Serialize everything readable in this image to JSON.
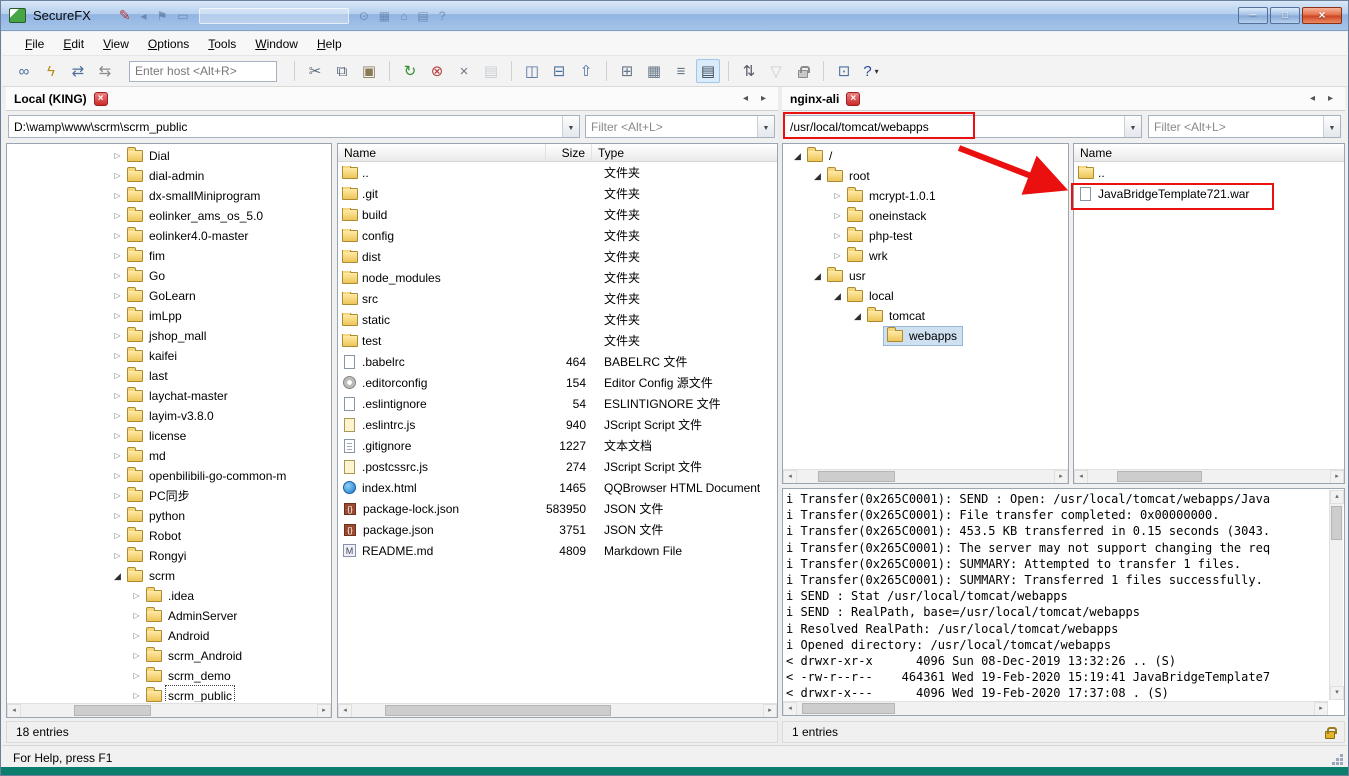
{
  "window": {
    "title": "SecureFX"
  },
  "menu": {
    "items": [
      "File",
      "Edit",
      "View",
      "Options",
      "Tools",
      "Window",
      "Help"
    ]
  },
  "toolbar": {
    "host_placeholder": "Enter host <Alt+R>",
    "buttons": [
      {
        "name": "connect-icon",
        "glyph": "∞",
        "color": "#4d6f9d"
      },
      {
        "name": "quick-connect-icon",
        "glyph": "ϟ",
        "color": "#b98c1e"
      },
      {
        "name": "reconnect-icon",
        "glyph": "⇄",
        "color": "#4d6f9d"
      },
      {
        "name": "connect-in-tab-icon",
        "glyph": "⇆",
        "color": "#8a8a8a"
      },
      {
        "host": true
      },
      {
        "sep": true
      },
      {
        "name": "cut-icon",
        "glyph": "✂",
        "color": "#5a6b7c"
      },
      {
        "name": "copy-icon",
        "glyph": "⧉",
        "color": "#5a6b7c"
      },
      {
        "name": "paste-icon",
        "glyph": "▣",
        "color": "#8a7a55"
      },
      {
        "sep": true
      },
      {
        "name": "refresh-icon",
        "glyph": "↻",
        "color": "#2f8f2f"
      },
      {
        "name": "stop-icon",
        "glyph": "⊗",
        "color": "#b54040"
      },
      {
        "name": "delete-icon",
        "glyph": "×",
        "color": "#6a7a8a"
      },
      {
        "name": "properties-icon",
        "glyph": "▤",
        "color": "#98a4b0",
        "disabled": true
      },
      {
        "sep": true
      },
      {
        "name": "pane-layout-icon",
        "glyph": "◫",
        "color": "#4d6f9d"
      },
      {
        "name": "swap-panes-icon",
        "glyph": "⊟",
        "color": "#4d6f9d"
      },
      {
        "name": "folder-up-icon",
        "glyph": "⇧",
        "color": "#4d6f9d"
      },
      {
        "sep": true
      },
      {
        "name": "large-icons-view-icon",
        "glyph": "⊞",
        "color": "#667788"
      },
      {
        "name": "small-icons-view-icon",
        "glyph": "▦",
        "color": "#667788"
      },
      {
        "name": "list-view-icon",
        "glyph": "≡",
        "color": "#667788"
      },
      {
        "name": "details-view-icon",
        "glyph": "▤",
        "color": "#334455",
        "active": true
      },
      {
        "sep": true
      },
      {
        "name": "sort-icon",
        "glyph": "⇅",
        "color": "#556"
      },
      {
        "name": "filter-icon",
        "glyph": "▽",
        "color": "#99a",
        "disabled": true
      },
      {
        "name": "lock-icon",
        "glyph": "lock",
        "color": "#888"
      },
      {
        "sep": true
      },
      {
        "name": "transfer-window-icon",
        "glyph": "⊡",
        "color": "#4d6f9d"
      },
      {
        "name": "help-icon",
        "glyph": "?",
        "color": "#2a4a9a",
        "dropdown": true
      }
    ]
  },
  "left_pane": {
    "tab": "Local (KING)",
    "path": "D:\\wamp\\www\\scrm\\scrm_public",
    "filter_placeholder": "Filter <Alt+L>",
    "columns": [
      "Name",
      "Size",
      "Type"
    ],
    "tree": [
      {
        "label": "Dial",
        "level": 0,
        "state": "collapsed"
      },
      {
        "label": "dial-admin",
        "level": 0,
        "state": "collapsed"
      },
      {
        "label": "dx-smallMiniprogram",
        "level": 0,
        "state": "collapsed"
      },
      {
        "label": "eolinker_ams_os_5.0",
        "level": 0,
        "state": "collapsed"
      },
      {
        "label": "eolinker4.0-master",
        "level": 0,
        "state": "collapsed"
      },
      {
        "label": "fim",
        "level": 0,
        "state": "collapsed"
      },
      {
        "label": "Go",
        "level": 0,
        "state": "collapsed"
      },
      {
        "label": "GoLearn",
        "level": 0,
        "state": "collapsed"
      },
      {
        "label": "imLpp",
        "level": 0,
        "state": "collapsed"
      },
      {
        "label": "jshop_mall",
        "level": 0,
        "state": "collapsed"
      },
      {
        "label": "kaifei",
        "level": 0,
        "state": "collapsed"
      },
      {
        "label": "last",
        "level": 0,
        "state": "collapsed"
      },
      {
        "label": "laychat-master",
        "level": 0,
        "state": "collapsed"
      },
      {
        "label": "layim-v3.8.0",
        "level": 0,
        "state": "collapsed"
      },
      {
        "label": "license",
        "level": 0,
        "state": "collapsed"
      },
      {
        "label": "md",
        "level": 0,
        "state": "collapsed"
      },
      {
        "label": "openbilibili-go-common-m",
        "level": 0,
        "state": "collapsed"
      },
      {
        "label": "PC同步",
        "level": 0,
        "state": "collapsed"
      },
      {
        "label": "python",
        "level": 0,
        "state": "collapsed"
      },
      {
        "label": "Robot",
        "level": 0,
        "state": "collapsed"
      },
      {
        "label": "Rongyi",
        "level": 0,
        "state": "collapsed"
      },
      {
        "label": "scrm",
        "level": 0,
        "state": "expanded"
      },
      {
        "label": ".idea",
        "level": 1,
        "state": "collapsed"
      },
      {
        "label": "AdminServer",
        "level": 1,
        "state": "collapsed"
      },
      {
        "label": "Android",
        "level": 1,
        "state": "collapsed"
      },
      {
        "label": "scrm_Android",
        "level": 1,
        "state": "collapsed"
      },
      {
        "label": "scrm_demo",
        "level": 1,
        "state": "collapsed"
      },
      {
        "label": "scrm_public",
        "level": 1,
        "state": "collapsed",
        "selected": "focus"
      }
    ],
    "files": [
      {
        "name": "..",
        "size": "",
        "type": "文件夹",
        "icon": "folder"
      },
      {
        "name": ".git",
        "size": "",
        "type": "文件夹",
        "icon": "folder"
      },
      {
        "name": "build",
        "size": "",
        "type": "文件夹",
        "icon": "folder"
      },
      {
        "name": "config",
        "size": "",
        "type": "文件夹",
        "icon": "folder"
      },
      {
        "name": "dist",
        "size": "",
        "type": "文件夹",
        "icon": "folder"
      },
      {
        "name": "node_modules",
        "size": "",
        "type": "文件夹",
        "icon": "folder"
      },
      {
        "name": "src",
        "size": "",
        "type": "文件夹",
        "icon": "folder"
      },
      {
        "name": "static",
        "size": "",
        "type": "文件夹",
        "icon": "folder"
      },
      {
        "name": "test",
        "size": "",
        "type": "文件夹",
        "icon": "folder"
      },
      {
        "name": ".babelrc",
        "size": "464",
        "type": "BABELRC 文件",
        "icon": "file"
      },
      {
        "name": ".editorconfig",
        "size": "154",
        "type": "Editor Config 源文件",
        "icon": "config"
      },
      {
        "name": ".eslintignore",
        "size": "54",
        "type": "ESLINTIGNORE 文件",
        "icon": "file"
      },
      {
        "name": ".eslintrc.js",
        "size": "940",
        "type": "JScript Script 文件",
        "icon": "script"
      },
      {
        "name": ".gitignore",
        "size": "1227",
        "type": "文本文档",
        "icon": "text"
      },
      {
        "name": ".postcssrc.js",
        "size": "274",
        "type": "JScript Script 文件",
        "icon": "script"
      },
      {
        "name": "index.html",
        "size": "1465",
        "type": "QQBrowser HTML Document",
        "icon": "html"
      },
      {
        "name": "package-lock.json",
        "size": "583950",
        "type": "JSON 文件",
        "icon": "json"
      },
      {
        "name": "package.json",
        "size": "3751",
        "type": "JSON 文件",
        "icon": "json"
      },
      {
        "name": "README.md",
        "size": "4809",
        "type": "Markdown File",
        "icon": "markdown"
      }
    ],
    "status": "18 entries"
  },
  "right_pane": {
    "tab": "nginx-ali",
    "path": "/usr/local/tomcat/webapps",
    "filter_placeholder": "Filter <Alt+L>",
    "columns": [
      "Name"
    ],
    "tree": [
      {
        "label": "/",
        "level": 0,
        "state": "expanded"
      },
      {
        "label": "root",
        "level": 1,
        "state": "expanded"
      },
      {
        "label": "mcrypt-1.0.1",
        "level": 2,
        "state": "collapsed"
      },
      {
        "label": "oneinstack",
        "level": 2,
        "state": "collapsed"
      },
      {
        "label": "php-test",
        "level": 2,
        "state": "collapsed"
      },
      {
        "label": "wrk",
        "level": 2,
        "state": "collapsed"
      },
      {
        "label": "usr",
        "level": 1,
        "state": "expanded"
      },
      {
        "label": "local",
        "level": 2,
        "state": "expanded"
      },
      {
        "label": "tomcat",
        "level": 3,
        "state": "expanded"
      },
      {
        "label": "webapps",
        "level": 4,
        "state": "none",
        "selected": "highlight"
      }
    ],
    "files": [
      {
        "name": "..",
        "icon": "folder"
      },
      {
        "name": "JavaBridgeTemplate721.war",
        "icon": "file"
      }
    ],
    "status": "1 entries"
  },
  "log": {
    "lines": [
      "i Transfer(0x265C0001): SEND : Open: /usr/local/tomcat/webapps/Java",
      "i Transfer(0x265C0001): File transfer completed: 0x00000000.",
      "i Transfer(0x265C0001): 453.5 KB transferred in 0.15 seconds (3043.",
      "i Transfer(0x265C0001): The server may not support changing the req",
      "i Transfer(0x265C0001): SUMMARY: Attempted to transfer 1 files.",
      "i Transfer(0x265C0001): SUMMARY: Transferred 1 files successfully.",
      "i SEND : Stat /usr/local/tomcat/webapps",
      "i SEND : RealPath, base=/usr/local/tomcat/webapps",
      "i Resolved RealPath: /usr/local/tomcat/webapps",
      "i Opened directory: /usr/local/tomcat/webapps",
      "< drwxr-xr-x      4096 Sun 08-Dec-2019 13:32:26 .. (S)",
      "< -rw-r--r--    464361 Wed 19-Feb-2020 15:19:41 JavaBridgeTemplate7",
      "< drwxr-x---      4096 Wed 19-Feb-2020 17:37:08 . (S)"
    ]
  },
  "status_bar": {
    "text": "For Help, press F1"
  }
}
